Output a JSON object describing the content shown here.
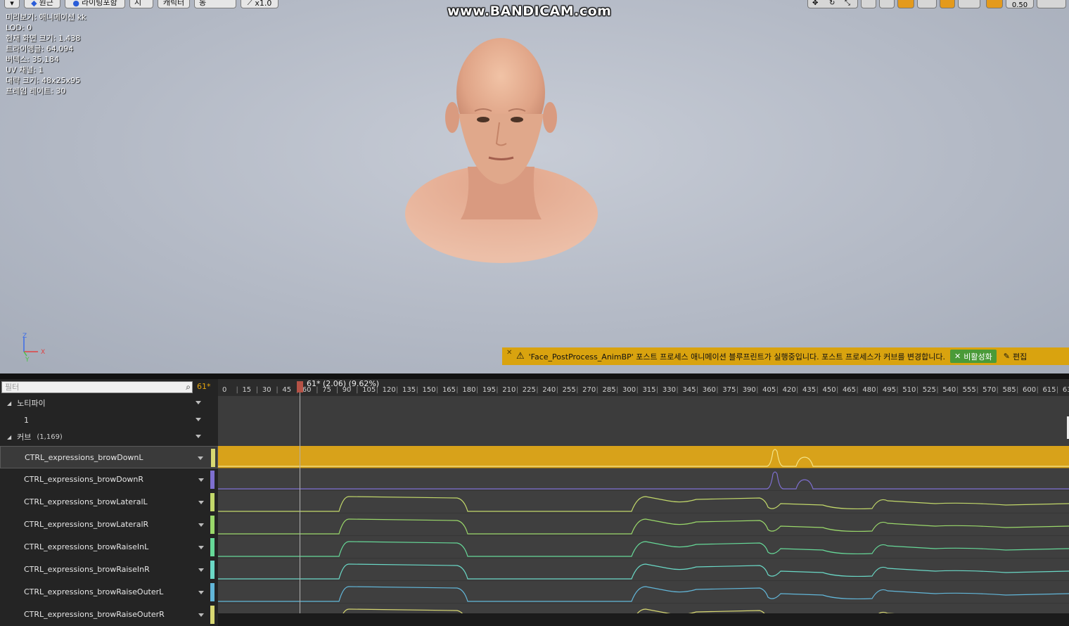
{
  "toolbar": {
    "buttons": [
      {
        "label": "",
        "icon": "chevron-down-icon"
      },
      {
        "label": "원근",
        "icon": "perspective-icon"
      },
      {
        "label": "라이팅포함",
        "icon": "lit-sphere-icon"
      },
      {
        "label": "표시",
        "icon": ""
      },
      {
        "label": "캐릭터",
        "icon": ""
      },
      {
        "label": "LOD 자동",
        "icon": ""
      },
      {
        "label": "x1.0",
        "icon": "speed-icon"
      }
    ],
    "right_icons": [
      "transform-icon",
      "rotate-icon",
      "scale-icon",
      "world-icon",
      "snap-icon",
      "grid-icon",
      "grid-snap-icon",
      "angle-icon",
      "angle-snap-icon",
      "scale-snap-icon",
      "camera-speed-icon",
      "maximize-icon"
    ],
    "camera_speed": "0.50"
  },
  "watermark": "www.BANDICAM.com",
  "stats": [
    "미리보기: 애니메이션 kk",
    "LOD: 0",
    "현재 화면 크기: 1.438",
    "트라이앵글: 64,094",
    "버텍스: 35,184",
    "UV 채널: 1",
    "대략 크기: 48x25x95",
    "프레임 레이트: 30"
  ],
  "axis": {
    "z": "Z",
    "x": "X",
    "y": "Y"
  },
  "notice": {
    "message": "'Face_PostProcess_AnimBP' 포스트 프로세스 애니메이션 블루프린트가 실행중입니다. 포스트 프로세스가 커브를 변경합니다.",
    "disable_label": "비활성화",
    "edit_label": "편집"
  },
  "filter": {
    "placeholder": "필터"
  },
  "frame_count": "61*",
  "tree": {
    "notifies_label": "노티파이",
    "notify_track": "1",
    "curves_label": "커브",
    "curves_count": "(1,169)"
  },
  "curves": [
    {
      "name": "CTRL_expressions_browDownL",
      "color": "#d8d872",
      "selected": true
    },
    {
      "name": "CTRL_expressions_browDownR",
      "color": "#7e6fd0"
    },
    {
      "name": "CTRL_expressions_browLateralL",
      "color": "#c2d86a"
    },
    {
      "name": "CTRL_expressions_browLateralR",
      "color": "#9ad86a"
    },
    {
      "name": "CTRL_expressions_browRaiseInL",
      "color": "#66d898"
    },
    {
      "name": "CTRL_expressions_browRaiseInR",
      "color": "#6ad8c6"
    },
    {
      "name": "CTRL_expressions_browRaiseOuterL",
      "color": "#62b6d8"
    },
    {
      "name": "CTRL_expressions_browRaiseOuterR",
      "color": "#d8d872"
    }
  ],
  "timeline": {
    "playhead_label": "61* (2.06) (9.62%)",
    "ticks": [
      "0",
      "15",
      "30",
      "45",
      "60",
      "75",
      "90",
      "105",
      "120",
      "135",
      "150",
      "165",
      "180",
      "195",
      "210",
      "225",
      "240",
      "255",
      "270",
      "285",
      "300",
      "315",
      "330",
      "345",
      "360",
      "375",
      "390",
      "405",
      "420",
      "435",
      "450",
      "465",
      "480",
      "495",
      "510",
      "525",
      "540",
      "555",
      "570",
      "585",
      "600",
      "615",
      "63"
    ],
    "accent": "#d8a21a"
  }
}
